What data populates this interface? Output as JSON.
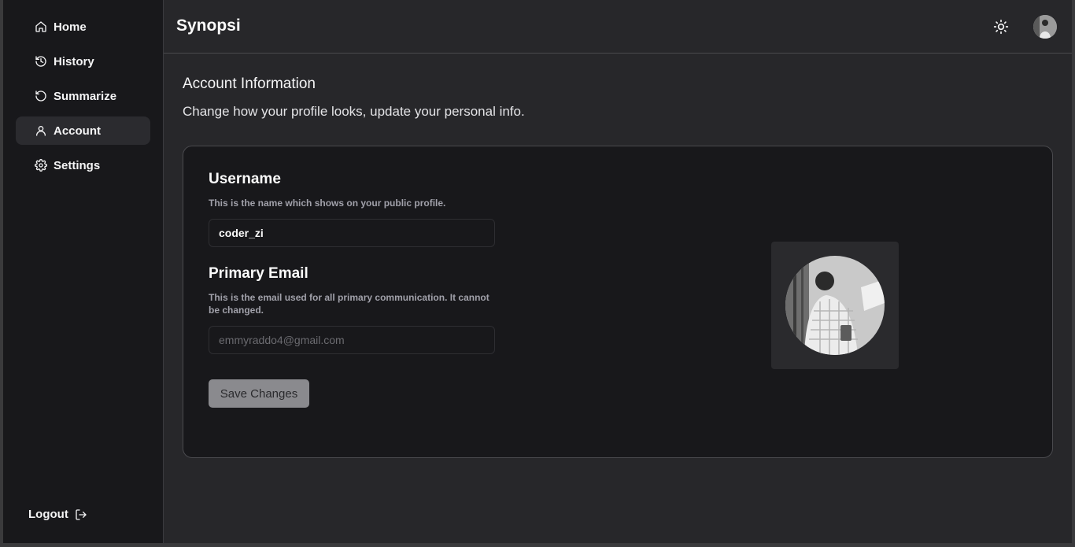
{
  "app": {
    "name": "Synopsi"
  },
  "sidebar": {
    "items": [
      {
        "label": "Home",
        "icon": "home-icon"
      },
      {
        "label": "History",
        "icon": "history-icon"
      },
      {
        "label": "Summarize",
        "icon": "refresh-icon"
      },
      {
        "label": "Account",
        "icon": "user-icon",
        "active": true
      },
      {
        "label": "Settings",
        "icon": "gear-icon"
      }
    ],
    "logout_label": "Logout"
  },
  "header": {
    "theme_icon": "sun-icon",
    "avatar_icon": "avatar"
  },
  "page": {
    "title": "Account Information",
    "subtitle": "Change how your profile looks, update your personal info."
  },
  "form": {
    "username": {
      "title": "Username",
      "description": "This is the name which shows on your public profile.",
      "value": "coder_zi"
    },
    "email": {
      "title": "Primary Email",
      "description": "This is the email used for all primary communication. It cannot be changed.",
      "value": "emmyraddo4@gmail.com"
    },
    "save_label": "Save Changes"
  },
  "colors": {
    "sidebar_bg": "#18181b",
    "main_bg": "#27272a",
    "active_item_bg": "#2b2b2f",
    "button_bg": "#8a8a8e"
  }
}
